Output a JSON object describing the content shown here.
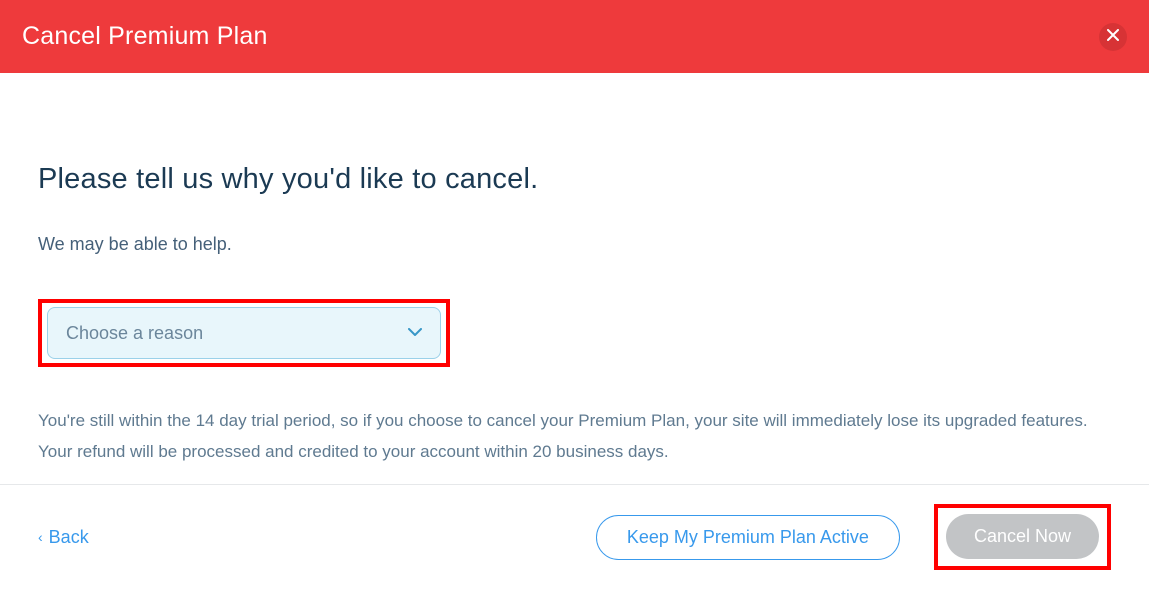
{
  "header": {
    "title": "Cancel Premium Plan"
  },
  "main": {
    "heading": "Please tell us why you'd like to cancel.",
    "subheading": "We may be able to help.",
    "reason_select": {
      "placeholder": "Choose a reason"
    },
    "info_text": "You're still within the 14 day trial period, so if you choose to cancel your Premium Plan, your site will immediately lose its upgraded features. Your refund will be processed and credited to your account within 20 business days."
  },
  "footer": {
    "back_label": "Back",
    "keep_active_label": "Keep My Premium Plan Active",
    "cancel_now_label": "Cancel Now"
  }
}
